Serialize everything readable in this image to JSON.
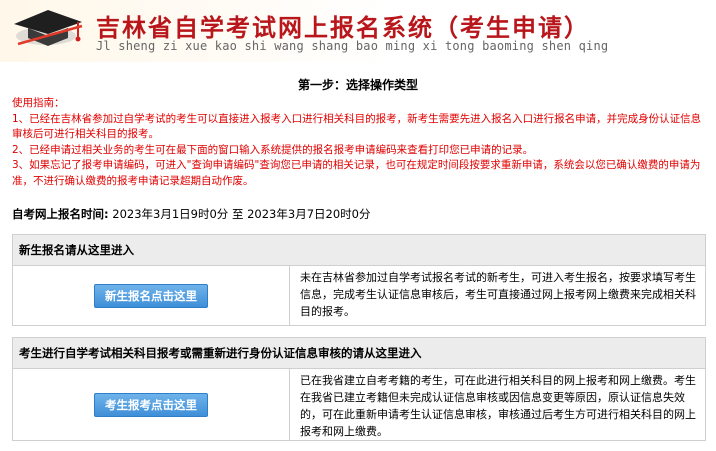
{
  "header": {
    "title": "吉林省自学考试网上报名系统（考生申请）",
    "subtitle": "Jl sheng zi xue kao shi wang shang bao ming xi tong baoming shen qing",
    "logo_icon": "graduation-cap-icon"
  },
  "step_title": "第一步：选择操作类型",
  "guide": {
    "heading": "使用指南：",
    "items": [
      "1、已经在吉林省参加过自学考试的考生可以直接进入报考入口进行相关科目的报考，新考生需要先进入报名入口进行报名申请，并完成身份认证信息审核后可进行相关科目的报考。",
      "2、已经申请过相关业务的考生可在最下面的窗口输入系统提供的报名报考申请编码来查看打印您已申请的记录。",
      "3、如果忘记了报考申请编码，可进入\"查询申请编码\"查询您已申请的相关记录，也可在规定时间段按要求重新申请，系统会以您已确认缴费的申请为准，不进行确认缴费的报考申请记录超期自动作废。"
    ]
  },
  "registration_time": {
    "label": "自考网上报名时间:",
    "value": " 2023年3月1日9时0分 至 2023年3月7日20时0分"
  },
  "new_student": {
    "header": "新生报名请从这里进入",
    "button": "新生报名点击这里",
    "description": "未在吉林省参加过自学考试报名考试的新考生，可进入考生报名，按要求填写考生信息，完成考生认证信息审核后，考生可直接通过网上报考网上缴费来完成相关科目的报考。"
  },
  "exam_apply": {
    "header": "考生进行自学考试相关科目报考或需重新进行身份认证信息审核的请从这里进入",
    "button": "考生报考点击这里",
    "description": "已在我省建立自考考籍的考生，可在此进行相关科目的网上报考和网上缴费。考生在我省已建立考籍但未完成认证信息审核或因信息变更等原因，原认证信息失效的，可在此重新申请考生认证信息审核，审核通过后考生方可进行相关科目的网上报考和网上缴费。"
  }
}
